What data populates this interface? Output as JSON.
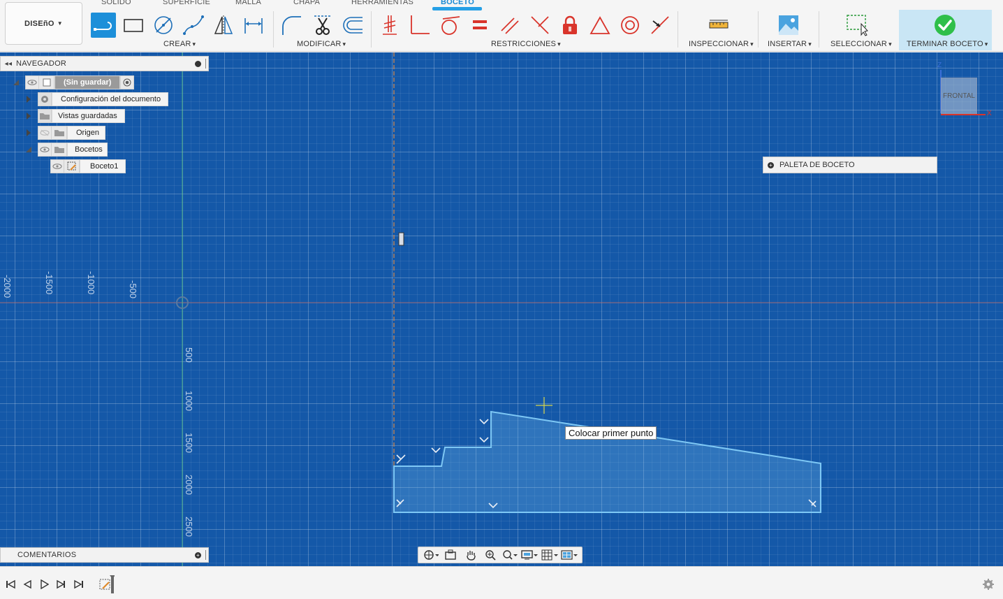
{
  "workspace_menu": {
    "label": "DISEñO"
  },
  "tabs": [
    {
      "label": "SÓLIDO",
      "active": false
    },
    {
      "label": "SUPERFICIE",
      "active": false
    },
    {
      "label": "MALLA",
      "active": false
    },
    {
      "label": "CHAPA",
      "active": false
    },
    {
      "label": "HERRAMIENTAS",
      "active": false
    },
    {
      "label": "BOCETO",
      "active": true
    }
  ],
  "groups": {
    "create": "CREAR",
    "modify": "MODIFICAR",
    "constraints": "RESTRICCIONES",
    "inspect": "INSPECCIONAR",
    "insert": "INSERTAR",
    "select": "SELECCIONAR",
    "finish": "TERMINAR BOCETO"
  },
  "tools": {
    "create": [
      "line-icon",
      "rectangle-icon",
      "circle-icon",
      "spline-icon",
      "mirror-icon",
      "dimension-icon"
    ],
    "modify": [
      "fillet-icon",
      "trim-icon",
      "offset-icon"
    ],
    "constraints": [
      "coincident-icon",
      "perpendicular-icon",
      "tangent-icon",
      "equal-icon",
      "parallel-icon",
      "perpendicular-cross-icon",
      "fix-lock-icon",
      "triangle-icon",
      "concentric-icon",
      "midpoint-icon"
    ],
    "inspect": [
      "measure-icon"
    ],
    "insert": [
      "image-icon"
    ],
    "select": [
      "selection-icon"
    ],
    "finish": [
      "finish-check-icon"
    ]
  },
  "navigator": {
    "title": "NAVEGADOR",
    "root": "(Sin guardar)",
    "items": [
      {
        "label": "Configuración del documento",
        "icon": "gear-icon"
      },
      {
        "label": "Vistas guardadas",
        "icon": "folder-icon"
      },
      {
        "label": "Origen",
        "icon": "folder-icon"
      },
      {
        "label": "Bocetos",
        "icon": "folder-icon"
      }
    ],
    "sketch": "Boceto1"
  },
  "palette": {
    "title": "PALETA DE BOCETO"
  },
  "tooltip": {
    "text": "Colocar primer punto"
  },
  "comments": {
    "title": "COMENTARIOS"
  },
  "viewcube": {
    "face": "FRONTAL",
    "axis_z": "Z",
    "axis_x": "X"
  },
  "axis_labels": {
    "horizontal": [
      "-2000",
      "-1500",
      "-1000",
      "-500"
    ],
    "vertical": [
      "500",
      "1000",
      "1500",
      "2000",
      "2500"
    ]
  },
  "colors": {
    "canvas": "#1458a8",
    "sketch_line": "#7ec8f5",
    "accent": "#1d8fd9",
    "finish_check": "#2fbf4a",
    "constraint_red": "#d9342b"
  }
}
